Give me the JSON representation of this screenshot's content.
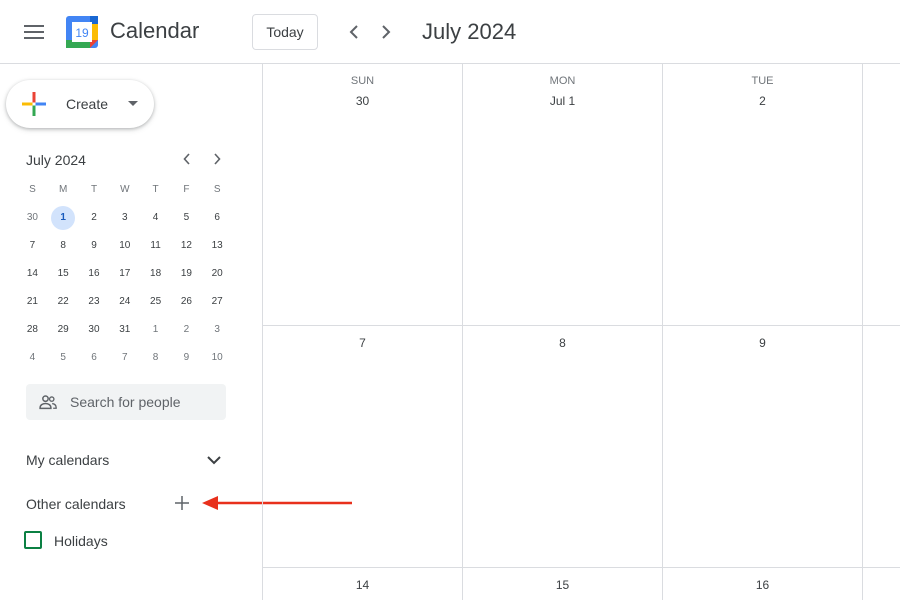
{
  "header": {
    "app_title": "Calendar",
    "logo_day": "19",
    "today_label": "Today",
    "month_title": "July 2024"
  },
  "sidebar": {
    "create_label": "Create",
    "mini_calendar": {
      "title": "July 2024",
      "weekday_headers": [
        "S",
        "M",
        "T",
        "W",
        "T",
        "F",
        "S"
      ],
      "selected_day": "1",
      "weeks": [
        [
          {
            "d": "30",
            "m": true
          },
          {
            "d": "1",
            "m": false
          },
          {
            "d": "2",
            "m": false
          },
          {
            "d": "3",
            "m": false
          },
          {
            "d": "4",
            "m": false
          },
          {
            "d": "5",
            "m": false
          },
          {
            "d": "6",
            "m": false
          }
        ],
        [
          {
            "d": "7",
            "m": false
          },
          {
            "d": "8",
            "m": false
          },
          {
            "d": "9",
            "m": false
          },
          {
            "d": "10",
            "m": false
          },
          {
            "d": "11",
            "m": false
          },
          {
            "d": "12",
            "m": false
          },
          {
            "d": "13",
            "m": false
          }
        ],
        [
          {
            "d": "14",
            "m": false
          },
          {
            "d": "15",
            "m": false
          },
          {
            "d": "16",
            "m": false
          },
          {
            "d": "17",
            "m": false
          },
          {
            "d": "18",
            "m": false
          },
          {
            "d": "19",
            "m": false
          },
          {
            "d": "20",
            "m": false
          }
        ],
        [
          {
            "d": "21",
            "m": false
          },
          {
            "d": "22",
            "m": false
          },
          {
            "d": "23",
            "m": false
          },
          {
            "d": "24",
            "m": false
          },
          {
            "d": "25",
            "m": false
          },
          {
            "d": "26",
            "m": false
          },
          {
            "d": "27",
            "m": false
          }
        ],
        [
          {
            "d": "28",
            "m": false
          },
          {
            "d": "29",
            "m": false
          },
          {
            "d": "30",
            "m": false
          },
          {
            "d": "31",
            "m": false
          },
          {
            "d": "1",
            "m": true
          },
          {
            "d": "2",
            "m": true
          },
          {
            "d": "3",
            "m": true
          }
        ],
        [
          {
            "d": "4",
            "m": true
          },
          {
            "d": "5",
            "m": true
          },
          {
            "d": "6",
            "m": true
          },
          {
            "d": "7",
            "m": true
          },
          {
            "d": "8",
            "m": true
          },
          {
            "d": "9",
            "m": true
          },
          {
            "d": "10",
            "m": true
          }
        ]
      ]
    },
    "search_placeholder": "Search for people",
    "my_calendars_label": "My calendars",
    "other_calendars_label": "Other calendars",
    "calendars": [
      {
        "label": "Holidays",
        "color": "#0b8043",
        "checked": false
      }
    ]
  },
  "month_grid": {
    "day_names": [
      "SUN",
      "MON",
      "TUE"
    ],
    "weeks": [
      [
        "30",
        "Jul 1",
        "2"
      ],
      [
        "7",
        "8",
        "9"
      ],
      [
        "14",
        "15",
        "16"
      ]
    ]
  },
  "colors": {
    "accent": "#1a73e8",
    "annotation_arrow": "#e8301c",
    "selected_day_bg": "#d2e3fc"
  }
}
